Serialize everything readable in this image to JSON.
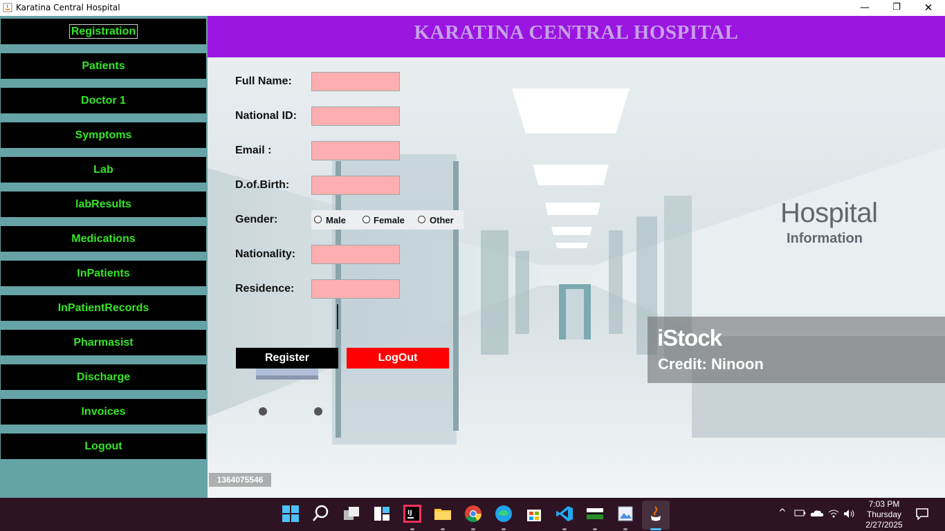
{
  "window": {
    "title": "Karatina Central Hospital",
    "minimize": "—",
    "maximize": "❐",
    "close": "✕"
  },
  "sidebar": {
    "items": [
      {
        "label": "Registration",
        "focused": true
      },
      {
        "label": "Patients"
      },
      {
        "label": "Doctor 1"
      },
      {
        "label": "Symptoms"
      },
      {
        "label": "Lab"
      },
      {
        "label": "labResults"
      },
      {
        "label": "Medications"
      },
      {
        "label": "InPatients"
      },
      {
        "label": "InPatientRecords"
      },
      {
        "label": "Pharmasist"
      },
      {
        "label": "Discharge"
      },
      {
        "label": "Invoices"
      },
      {
        "label": "Logout"
      }
    ]
  },
  "header": {
    "title": "KARATINA CENTRAL HOSPITAL"
  },
  "form": {
    "full_name_label": "Full Name:",
    "full_name_value": "",
    "national_id_label": "National ID:",
    "national_id_value": "",
    "email_label": "Email :",
    "email_value": "",
    "dob_label": "D.of.Birth:",
    "dob_value": "",
    "gender_label": "Gender:",
    "gender_options": [
      "Male",
      "Female",
      "Other"
    ],
    "nationality_label": "Nationality:",
    "nationality_value": "",
    "residence_label": "Residence:",
    "residence_value": "",
    "register_label": "Register",
    "logout_label": "LogOut"
  },
  "background": {
    "wall_sign_title": "Hospital",
    "wall_sign_sub": "Information",
    "stock_logo": "iStock",
    "stock_credit": "Credit: Ninoon",
    "stock_id": "1364075546"
  },
  "taskbar": {
    "icons": [
      "windows-start-icon",
      "search-icon",
      "task-view-icon",
      "widgets-icon",
      "intellij-icon",
      "file-explorer-icon",
      "chrome-icon",
      "edge-icon",
      "microsoft-store-icon",
      "vscode-icon",
      "app-icon",
      "image-viewer-icon",
      "java-icon"
    ],
    "clock_time": "7:03 PM",
    "clock_day": "Thursday",
    "clock_date": "2/27/2025"
  },
  "colors": {
    "sidebar_bg": "#66a3a6",
    "nav_bg": "#000000",
    "nav_text": "#33e624",
    "header_bg": "#9a16e0",
    "header_text": "#c7a0e8",
    "field_bg": "#fcaeb0",
    "logout_bg": "#ff0000"
  }
}
